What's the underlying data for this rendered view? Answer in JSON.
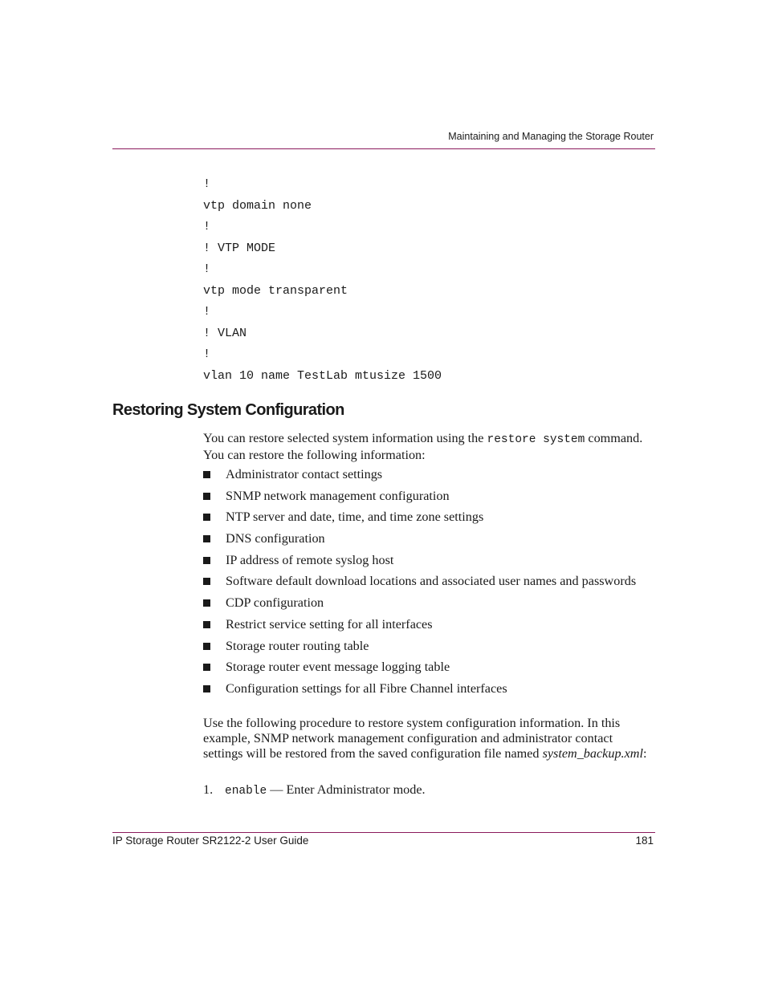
{
  "header": {
    "running_title": "Maintaining and Managing the Storage Router",
    "rule_color": "#8b1a5c"
  },
  "code_block": {
    "lines": [
      "!",
      "vtp domain none",
      "!",
      "! VTP MODE",
      "!",
      "vtp mode transparent",
      "!",
      "! VLAN",
      "!",
      "vlan 10 name TestLab mtusize 1500"
    ]
  },
  "section": {
    "title": "Restoring System Configuration",
    "intro_before": "You can restore selected system information using the ",
    "intro_command": "restore system",
    "intro_after": " command. You can restore the following information:",
    "bullets": [
      "Administrator contact settings",
      "SNMP network management configuration",
      "NTP server and date, time, and time zone settings",
      "DNS configuration",
      "IP address of remote syslog host",
      "Software default download locations and associated user names and passwords",
      "CDP configuration",
      "Restrict service setting for all interfaces",
      "Storage router routing table",
      "Storage router event message logging table",
      "Configuration settings for all Fibre Channel interfaces"
    ],
    "procedure_text": "Use the following procedure to restore system configuration information. In this example, SNMP network management configuration and administrator contact settings will be restored from the saved configuration file named ",
    "procedure_filename": "system_backup.xml",
    "procedure_end": ":",
    "steps": [
      {
        "number": "1.",
        "command": "enable",
        "description": " — Enter Administrator mode."
      }
    ]
  },
  "footer": {
    "guide_title": "IP Storage Router SR2122-2 User Guide",
    "page_number": "181"
  }
}
